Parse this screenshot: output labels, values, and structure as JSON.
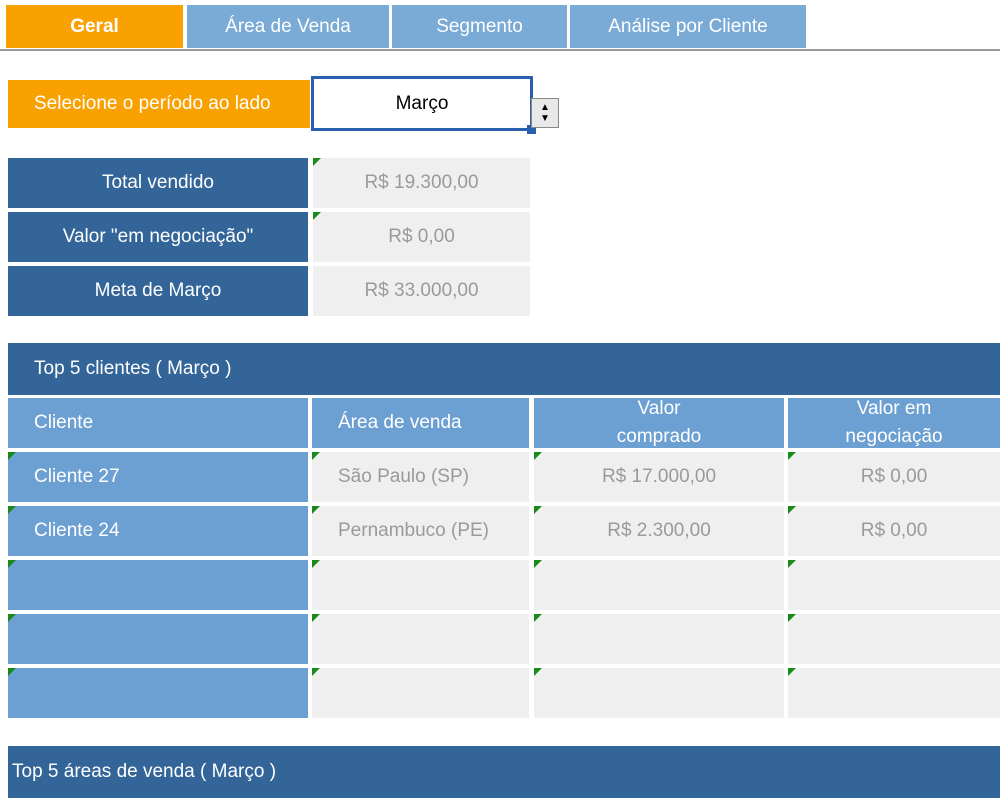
{
  "tabs": [
    {
      "label": "Geral",
      "active": true
    },
    {
      "label": "Área de Venda",
      "active": false
    },
    {
      "label": "Segmento",
      "active": false
    },
    {
      "label": "Análise por Cliente",
      "active": false
    }
  ],
  "period": {
    "label": "Selecione o período ao lado",
    "value": "Março"
  },
  "summary": [
    {
      "label": "Total vendido",
      "value": "R$ 19.300,00"
    },
    {
      "label": "Valor \"em negociação\"",
      "value": "R$ 0,00"
    },
    {
      "label": "Meta de Março",
      "value": "R$ 33.000,00"
    }
  ],
  "top_clients": {
    "title": "Top 5 clientes ( Março )",
    "headers": {
      "client": "Cliente",
      "area": "Área de venda",
      "bought_line1": "Valor",
      "bought_line2": "comprado",
      "negotiation_line1": "Valor em",
      "negotiation_line2": "negociação"
    },
    "rows": [
      {
        "client": "Cliente 27",
        "area": "São Paulo (SP)",
        "bought": "R$ 17.000,00",
        "negotiation": "R$ 0,00"
      },
      {
        "client": "Cliente 24",
        "area": "Pernambuco (PE)",
        "bought": "R$ 2.300,00",
        "negotiation": "R$ 0,00"
      },
      {
        "client": "",
        "area": "",
        "bought": "",
        "negotiation": ""
      },
      {
        "client": "",
        "area": "",
        "bought": "",
        "negotiation": ""
      },
      {
        "client": "",
        "area": "",
        "bought": "",
        "negotiation": ""
      }
    ]
  },
  "top_areas": {
    "title": "Top 5 áreas de venda ( Março )"
  },
  "colors": {
    "accent_orange": "#f9a100",
    "dark_blue": "#336599",
    "light_blue": "#6c9fd2",
    "tab_blue": "#7aaad6",
    "cell_grey": "#efefef",
    "comment_flag_green": "#1a8a1a"
  }
}
